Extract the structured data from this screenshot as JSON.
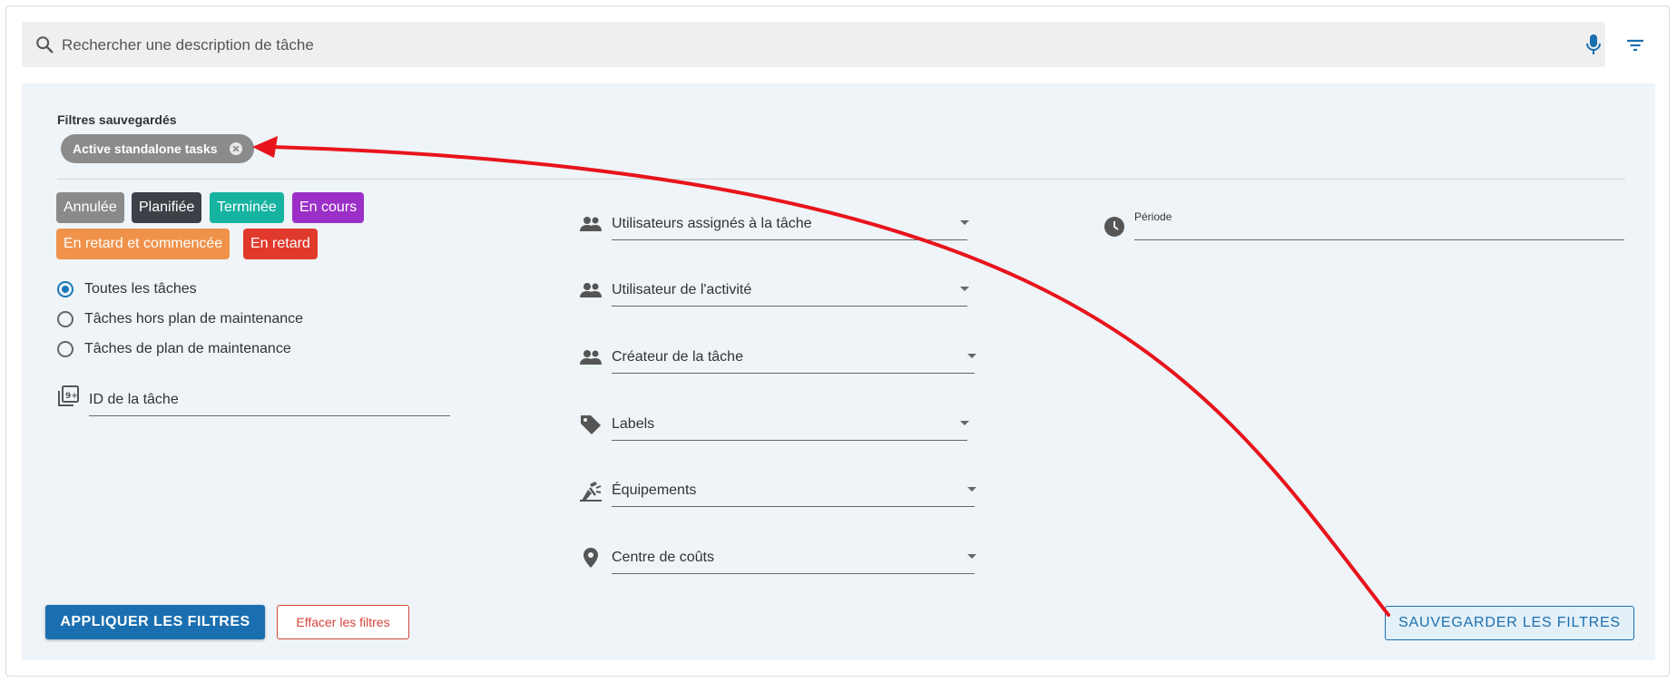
{
  "search": {
    "placeholder": "Rechercher une description de tâche"
  },
  "saved_filters": {
    "title": "Filtres sauvegardés",
    "chips": [
      {
        "label": "Active standalone tasks"
      }
    ]
  },
  "status_tags": [
    {
      "label": "Annulée",
      "color": "#8a8a8a"
    },
    {
      "label": "Planifiée",
      "color": "#3c4147"
    },
    {
      "label": "Terminée",
      "color": "#16b3a0"
    },
    {
      "label": "En cours",
      "color": "#9b2fc7"
    },
    {
      "label": "En retard et commencée",
      "color": "#f0924a"
    },
    {
      "label": "En retard",
      "color": "#e13a2c"
    }
  ],
  "task_scope": {
    "selected": "Toutes les tâches",
    "options": [
      {
        "label": "Toutes les tâches"
      },
      {
        "label": "Tâches hors plan de maintenance"
      },
      {
        "label": "Tâches de plan de maintenance"
      }
    ]
  },
  "task_id_field": {
    "label": "ID de la tâche"
  },
  "dropdowns": [
    {
      "label": "Utilisateurs assignés à la tâche",
      "icon": "group-icon"
    },
    {
      "label": "Utilisateur de l'activité",
      "icon": "group-icon"
    },
    {
      "label": "Créateur de la tâche",
      "icon": "group-icon"
    },
    {
      "label": "Labels",
      "icon": "tag-icon"
    },
    {
      "label": "Équipements",
      "icon": "equipment-icon"
    },
    {
      "label": "Centre de coûts",
      "icon": "location-pin-icon"
    }
  ],
  "period_field": {
    "label": "Période",
    "icon": "clock-icon"
  },
  "actions": {
    "apply": "APPLIQUER LES FILTRES",
    "clear": "Effacer les filtres",
    "save": "SAUVEGARDER LES FILTRES"
  },
  "colors": {
    "primary": "#1a6fb0",
    "panel_background": "#eef4f8",
    "annotation_arrow": "#e8141c"
  }
}
